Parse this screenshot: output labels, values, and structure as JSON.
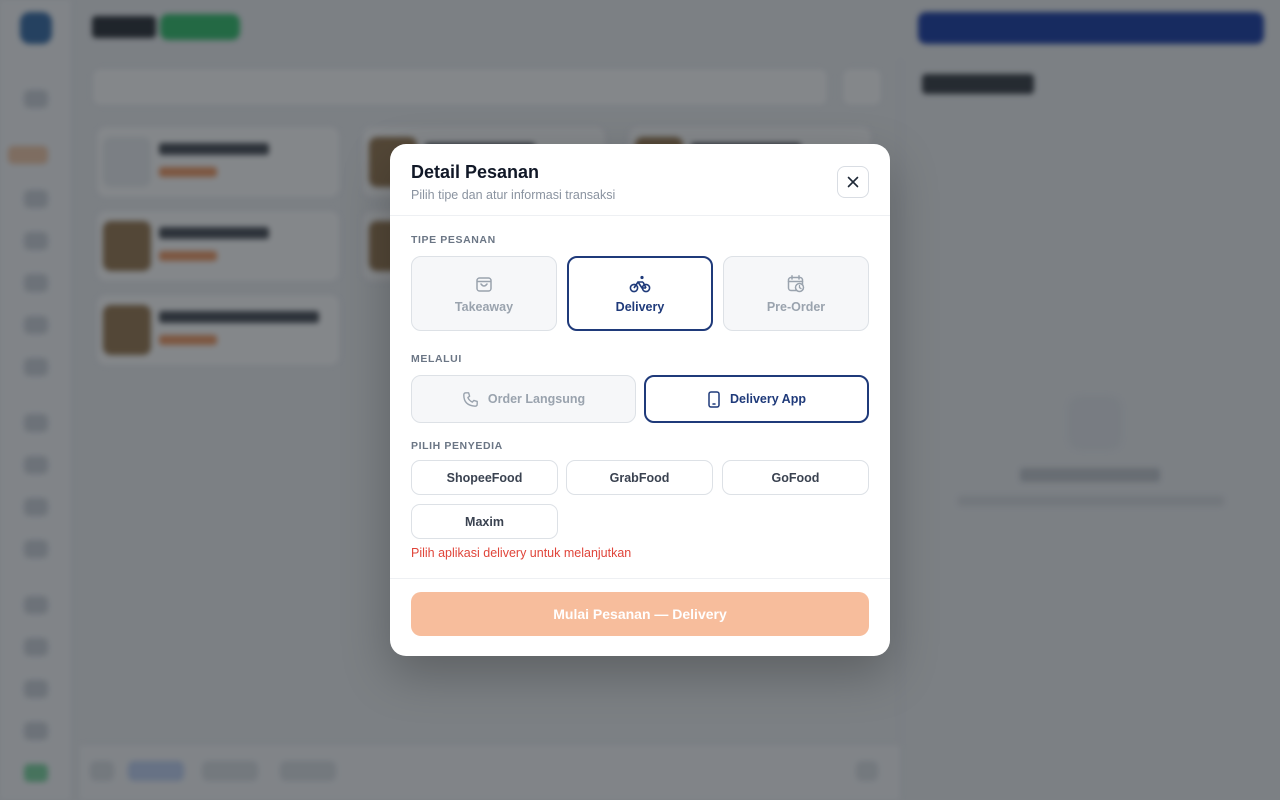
{
  "modal": {
    "title": "Detail Pesanan",
    "subtitle": "Pilih tipe dan atur informasi transaksi",
    "close_icon": "close-icon",
    "order_type": {
      "label": "TIPE PESANAN",
      "options": [
        {
          "label": "Takeaway",
          "icon": "shopping-bag-icon",
          "selected": false
        },
        {
          "label": "Delivery",
          "icon": "bicycle-icon",
          "selected": true
        },
        {
          "label": "Pre-Order",
          "icon": "calendar-clock-icon",
          "selected": false
        }
      ]
    },
    "via": {
      "label": "MELALUI",
      "options": [
        {
          "label": "Order Langsung",
          "icon": "phone-icon",
          "selected": false
        },
        {
          "label": "Delivery App",
          "icon": "smartphone-icon",
          "selected": true
        }
      ]
    },
    "provider": {
      "label": "PILIH PENYEDIA",
      "options": [
        "ShopeeFood",
        "GrabFood",
        "GoFood",
        "Maxim"
      ]
    },
    "error": "Pilih aplikasi delivery untuk melanjutkan",
    "submit": {
      "label": "Mulai Pesanan — Delivery",
      "enabled": false
    }
  },
  "colors": {
    "accent": "#1f3a7a",
    "submit_disabled": "#f7bd9c",
    "error": "#e0453a",
    "overlay": "rgba(20,24,30,0.52)"
  }
}
